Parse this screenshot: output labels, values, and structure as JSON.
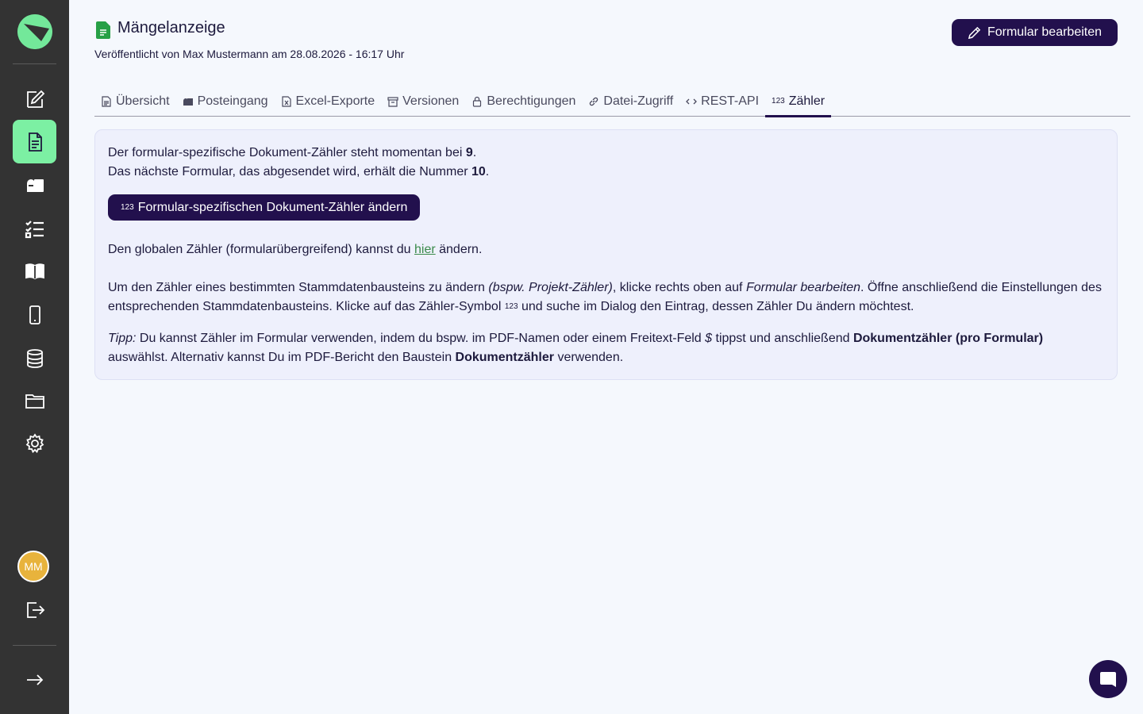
{
  "sidebar": {
    "logo": "app-logo",
    "items": [
      {
        "icon": "form-edit-icon"
      },
      {
        "icon": "document-icon",
        "active": true
      },
      {
        "icon": "inbox-icon"
      },
      {
        "icon": "checklist-icon"
      },
      {
        "icon": "book-icon"
      },
      {
        "icon": "mobile-icon"
      },
      {
        "icon": "database-icon"
      },
      {
        "icon": "folder-icon"
      },
      {
        "icon": "gear-icon"
      }
    ],
    "avatar_initials": "MM",
    "logout_icon": "logout-icon",
    "expand_icon": "arrow-right-icon"
  },
  "header": {
    "title": "Mängelanzeige",
    "published": "Veröffentlicht von Max Mustermann am 28.08.2026 - 16:17 Uhr",
    "edit_button": "Formular bearbeiten"
  },
  "tabs": [
    {
      "label": "Übersicht",
      "icon": "file-icon"
    },
    {
      "label": "Posteingang",
      "icon": "mailbox-icon"
    },
    {
      "label": "Excel-Exporte",
      "icon": "excel-file-icon"
    },
    {
      "label": "Versionen",
      "icon": "archive-icon"
    },
    {
      "label": "Berechtigungen",
      "icon": "lock-icon"
    },
    {
      "label": "Datei-Zugriff",
      "icon": "link-icon"
    },
    {
      "label": "REST-API",
      "icon": "code-icon"
    },
    {
      "label": "Zähler",
      "icon": "123",
      "active": true
    }
  ],
  "panel": {
    "line1_pre": "Der formular-spezifische Dokument-Zähler steht momentan bei ",
    "current_count": "9",
    "line2_pre": "Das nächste Formular, das abgesendet wird, erhält die Nummer ",
    "next_number": "10",
    "counter_button_icon": "123",
    "counter_button": "Formular-spezifischen Dokument-Zähler ändern",
    "global_pre": "Den globalen Zähler (formularübergreifend) kannst du ",
    "global_link": "hier",
    "global_post": " ändern.",
    "instr_1": "Um den Zähler eines bestimmten Stammdatenbausteins zu ändern ",
    "instr_italic_1": "(bspw. Projekt-Zähler)",
    "instr_2": ", klicke rechts oben auf ",
    "instr_italic_2": "Formular bearbeiten",
    "instr_3": ". Öffne anschließend die Einstellungen des entsprechenden Stammdatenbausteins. Klicke auf das Zähler-Symbol ",
    "instr_symbol": "123",
    "instr_4": " und suche im Dialog den Eintrag, dessen Zähler Du ändern möchtest.",
    "tipp_label": "Tipp:",
    "tipp_1": " Du kannst Zähler im Formular verwenden, indem du bspw. im PDF-Namen oder einem Freitext-Feld ",
    "tipp_dollar": "$",
    "tipp_2": " tippst und anschließend ",
    "tipp_bold_1": "Dokumentzähler (pro Formular)",
    "tipp_3": " auswählst. Alternativ kannst Du im PDF-Bericht den Baustein ",
    "tipp_bold_2": "Dokumentzähler",
    "tipp_4": " verwenden."
  },
  "chat": {
    "icon": "chat-icon"
  }
}
